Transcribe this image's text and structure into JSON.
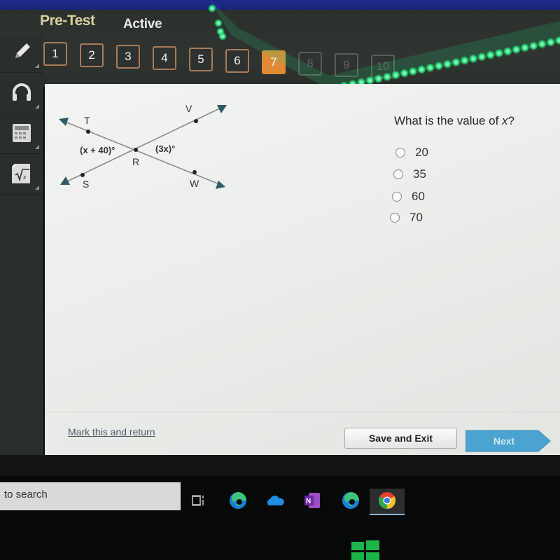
{
  "header": {
    "title": "Pre-Test",
    "status": "Active"
  },
  "question_nav": {
    "items": [
      {
        "label": "1",
        "state": "visited"
      },
      {
        "label": "2",
        "state": "visited"
      },
      {
        "label": "3",
        "state": "visited"
      },
      {
        "label": "4",
        "state": "visited"
      },
      {
        "label": "5",
        "state": "visited"
      },
      {
        "label": "6",
        "state": "visited"
      },
      {
        "label": "7",
        "state": "current"
      },
      {
        "label": "8",
        "state": "locked"
      },
      {
        "label": "9",
        "state": "locked"
      },
      {
        "label": "10",
        "state": "locked"
      }
    ],
    "current_color": "#e08a35"
  },
  "sidebar": {
    "tools": [
      {
        "name": "pencil-icon",
        "label": "Pencil"
      },
      {
        "name": "headphones-icon",
        "label": "Audio"
      },
      {
        "name": "calculator-icon",
        "label": "Calculator"
      },
      {
        "name": "formula-icon",
        "label": "Formula reference"
      }
    ]
  },
  "diagram": {
    "points": {
      "T": "T",
      "V": "V",
      "R": "R",
      "S": "S",
      "W": "W"
    },
    "angle_left": "(x + 40)°",
    "angle_right": "(3x)°"
  },
  "question": {
    "prefix": "What is the value of ",
    "variable": "x",
    "suffix": "?",
    "options": [
      "20",
      "35",
      "60",
      "70"
    ]
  },
  "footer": {
    "mark_link": "Mark this and return",
    "save_exit": "Save and Exit",
    "next": "Next",
    "next_color": "#4ba3d1"
  },
  "taskbar": {
    "search_text": "to search",
    "apps": [
      "task-view",
      "edge",
      "onedrive",
      "onenote",
      "edge",
      "chrome"
    ]
  }
}
